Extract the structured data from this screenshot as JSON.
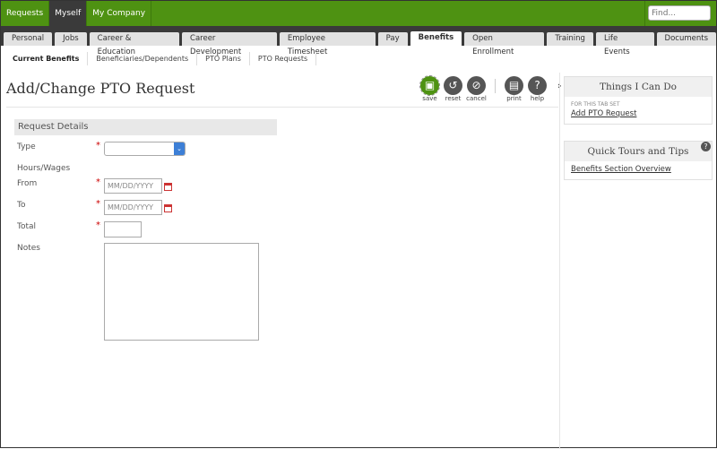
{
  "topnav": {
    "items": [
      "Requests",
      "Myself",
      "My Company"
    ],
    "active": 1,
    "find_placeholder": "Find..."
  },
  "tabs": {
    "items": [
      "Personal",
      "Jobs",
      "Career & Education",
      "Career Development",
      "Employee Timesheet",
      "Pay",
      "Benefits",
      "Open Enrollment",
      "Training",
      "Life Events",
      "Documents"
    ],
    "active": 6
  },
  "subtabs": {
    "items": [
      "Current Benefits",
      "Beneficiaries/Dependents",
      "PTO Plans",
      "PTO Requests"
    ],
    "active": 0
  },
  "page_title": "Add/Change PTO Request",
  "toolbar": {
    "save": "save",
    "reset": "reset",
    "cancel": "cancel",
    "print": "print",
    "help": "help"
  },
  "form": {
    "section": "Request Details",
    "type_label": "Type",
    "hours_label": "Hours/Wages",
    "from_label": "From",
    "from_placeholder": "MM/DD/YYYY",
    "to_label": "To",
    "to_placeholder": "MM/DD/YYYY",
    "total_label": "Total",
    "notes_label": "Notes"
  },
  "panel1": {
    "title": "Things I Can Do",
    "subtitle": "FOR THIS TAB SET",
    "link": "Add PTO Request"
  },
  "panel2": {
    "title": "Quick Tours and Tips",
    "link": "Benefits Section Overview"
  },
  "colors": {
    "brand": "#4e9212",
    "dark": "#3a3a3a"
  }
}
